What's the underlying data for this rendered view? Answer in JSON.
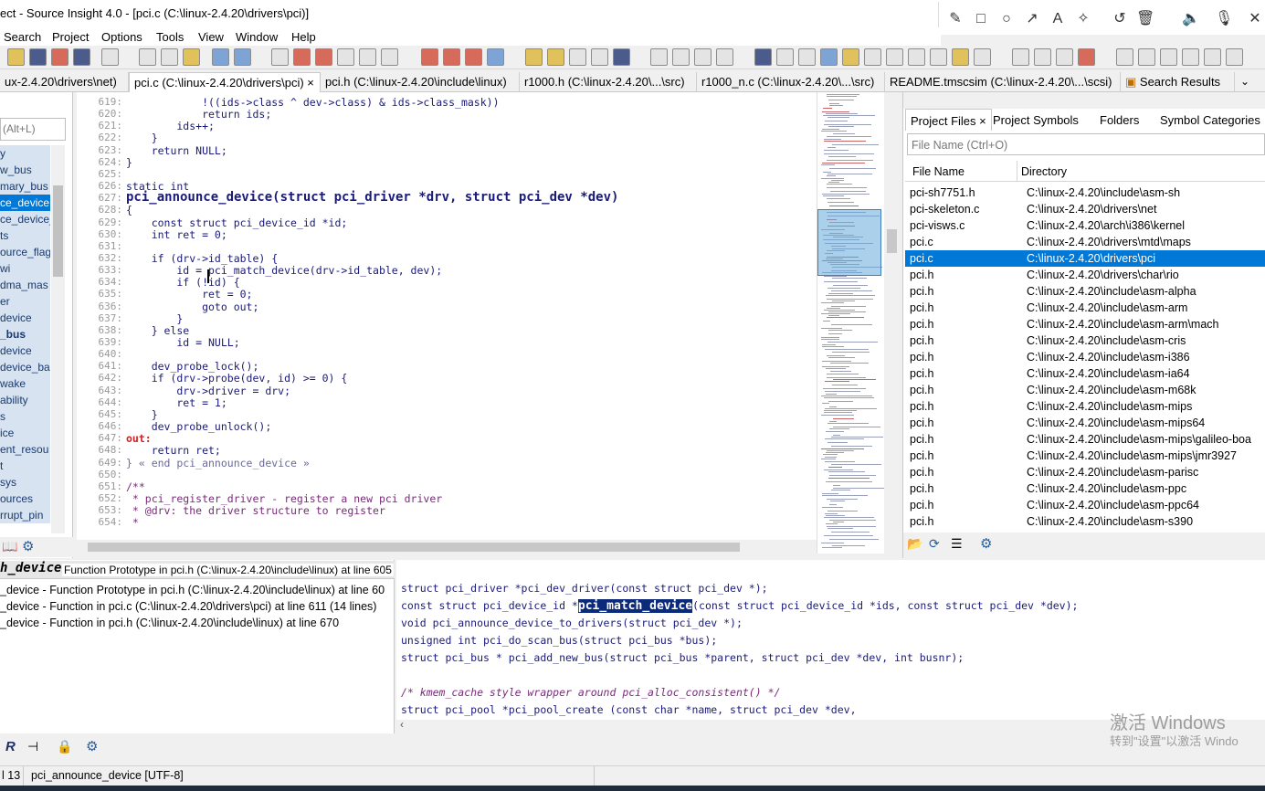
{
  "window": {
    "title": "ect - Source Insight 4.0 - [pci.c (C:\\linux-2.4.20\\drivers\\pci)]"
  },
  "annotate_tools": [
    "pen-icon",
    "rect-icon",
    "circle-icon",
    "arrow-icon",
    "text-icon",
    "magic-icon",
    "undo-icon",
    "trash-icon",
    "speaker-icon",
    "mic-icon",
    "close-icon"
  ],
  "menu": [
    "Search",
    "Project",
    "Options",
    "Tools",
    "View",
    "Window",
    "Help"
  ],
  "tabs": [
    {
      "label": "ux-2.4.20\\drivers\\net)"
    },
    {
      "label": "pci.c (C:\\linux-2.4.20\\drivers\\pci)",
      "close": "×"
    },
    {
      "label": "pci.h (C:\\linux-2.4.20\\include\\linux)"
    },
    {
      "label": "r1000.h (C:\\linux-2.4.20\\...\\src)"
    },
    {
      "label": "r1000_n.c (C:\\linux-2.4.20\\...\\src)"
    },
    {
      "label": "README.tmscsim (C:\\linux-2.4.20\\...\\scsi)"
    },
    {
      "label": "Search Results"
    }
  ],
  "sidebar": {
    "search_placeholder": "(Alt+L)",
    "symbols": [
      "y",
      "w_bus",
      "mary_bus",
      "ce_device",
      "ce_device_",
      "ts",
      "ource_flag",
      "wi",
      "dma_mas",
      "er",
      "device",
      "_bus",
      "device",
      "device_ba",
      "wake",
      "ability",
      "s",
      "ice",
      "ent_resou",
      "t",
      "sys",
      "ources",
      "rrupt_pin"
    ]
  },
  "editor": {
    "line_numbers": [
      "619:",
      "620:",
      "621:",
      "622:",
      "623:",
      "624:",
      "625:",
      "626:",
      "627:",
      "628:",
      "629:",
      "630:",
      "631:",
      "632:",
      "633:",
      "634:",
      "635:",
      "636:",
      "637:",
      "638:",
      "639:",
      "640:",
      "641:",
      "642:",
      "643:",
      "644:",
      "645:",
      "646:",
      "647:",
      "648:",
      "649:",
      "650:",
      "651:",
      "652:",
      "653:",
      "654:"
    ],
    "lines": [
      "            !((ids->class ^ dev->class) & ids->class_mask))",
      "            return ids;",
      "        ids++;",
      "    }",
      "    return NULL;",
      "}",
      "",
      "static int",
      "pci_announce_device(struct pci_driver *drv, struct pci_dev *dev)",
      "{",
      "    const struct pci_device_id *id;",
      "    int ret = 0;",
      "",
      "    if (drv->id_table) {",
      "        id = pci_match_device(drv->id_table, dev);",
      "        if (!id) {",
      "            ret = 0;",
      "            goto out;",
      "        }",
      "    } else",
      "        id = NULL;",
      "",
      "    dev_probe_lock();",
      "    if (drv->probe(dev, id) >= 0) {",
      "        drv->driver = drv;",
      "        ret = 1;",
      "    }",
      "    dev_probe_unlock();",
      "out:",
      "    return ret;",
      "} « end pci_announce_device »",
      "",
      "/**",
      " * pci_register_driver - register a new pci driver",
      " * @drv: the driver structure to register",
      " *"
    ]
  },
  "right_panel": {
    "tabs": [
      "Project Files",
      "Project Symbols",
      "Folders",
      "Symbol Categories"
    ],
    "tab_close": "×",
    "search_placeholder": "File Name (Ctrl+O)",
    "columns": [
      "File Name",
      "Directory"
    ],
    "files": [
      {
        "name": "pci-sh7751.h",
        "dir": "C:\\linux-2.4.20\\include\\asm-sh"
      },
      {
        "name": "pci-skeleton.c",
        "dir": "C:\\linux-2.4.20\\drivers\\net"
      },
      {
        "name": "pci-visws.c",
        "dir": "C:\\linux-2.4.20\\arch\\i386\\kernel"
      },
      {
        "name": "pci.c",
        "dir": "C:\\linux-2.4.20\\drivers\\mtd\\maps"
      },
      {
        "name": "pci.c",
        "dir": "C:\\linux-2.4.20\\drivers\\pci",
        "selected": true
      },
      {
        "name": "pci.h",
        "dir": "C:\\linux-2.4.20\\drivers\\char\\rio"
      },
      {
        "name": "pci.h",
        "dir": "C:\\linux-2.4.20\\include\\asm-alpha"
      },
      {
        "name": "pci.h",
        "dir": "C:\\linux-2.4.20\\include\\asm-arm"
      },
      {
        "name": "pci.h",
        "dir": "C:\\linux-2.4.20\\include\\asm-arm\\mach"
      },
      {
        "name": "pci.h",
        "dir": "C:\\linux-2.4.20\\include\\asm-cris"
      },
      {
        "name": "pci.h",
        "dir": "C:\\linux-2.4.20\\include\\asm-i386"
      },
      {
        "name": "pci.h",
        "dir": "C:\\linux-2.4.20\\include\\asm-ia64"
      },
      {
        "name": "pci.h",
        "dir": "C:\\linux-2.4.20\\include\\asm-m68k"
      },
      {
        "name": "pci.h",
        "dir": "C:\\linux-2.4.20\\include\\asm-mips"
      },
      {
        "name": "pci.h",
        "dir": "C:\\linux-2.4.20\\include\\asm-mips64"
      },
      {
        "name": "pci.h",
        "dir": "C:\\linux-2.4.20\\include\\asm-mips\\galileo-boa"
      },
      {
        "name": "pci.h",
        "dir": "C:\\linux-2.4.20\\include\\asm-mips\\jmr3927"
      },
      {
        "name": "pci.h",
        "dir": "C:\\linux-2.4.20\\include\\asm-parisc"
      },
      {
        "name": "pci.h",
        "dir": "C:\\linux-2.4.20\\include\\asm-ppc"
      },
      {
        "name": "pci.h",
        "dir": "C:\\linux-2.4.20\\include\\asm-ppc64"
      },
      {
        "name": "pci.h",
        "dir": "C:\\linux-2.4.20\\include\\asm-s390"
      }
    ]
  },
  "relation": {
    "symbol": "h_device",
    "header": "Function Prototype in pci.h (C:\\linux-2.4.20\\include\\linux) at line 605",
    "items": [
      "_device - Function Prototype in pci.h (C:\\linux-2.4.20\\include\\linux) at line 60",
      "_device - Function in pci.c (C:\\linux-2.4.20\\drivers\\pci) at line 611 (14 lines)",
      "_device - Function in pci.h (C:\\linux-2.4.20\\include\\linux) at line 670"
    ]
  },
  "context": {
    "lines": [
      "struct pci_driver *pci_dev_driver(const struct pci_dev *);",
      "const struct pci_device_id *pci_match_device(const struct pci_device_id *ids, const struct pci_dev *dev);",
      "void pci_announce_device_to_drivers(struct pci_dev *);",
      "unsigned int pci_do_scan_bus(struct pci_bus *bus);",
      "struct pci_bus * pci_add_new_bus(struct pci_bus *parent, struct pci_dev *dev, int busnr);",
      "",
      "/* kmem_cache style wrapper around pci_alloc_consistent() */",
      "struct pci_pool *pci_pool_create (const char *name, struct pci_dev *dev,"
    ]
  },
  "watermark": {
    "line1": "激活 Windows",
    "line2": "转到\"设置\"以激活 Windo"
  },
  "status": {
    "line": "l 13",
    "symbol": "pci_announce_device [UTF-8]"
  }
}
